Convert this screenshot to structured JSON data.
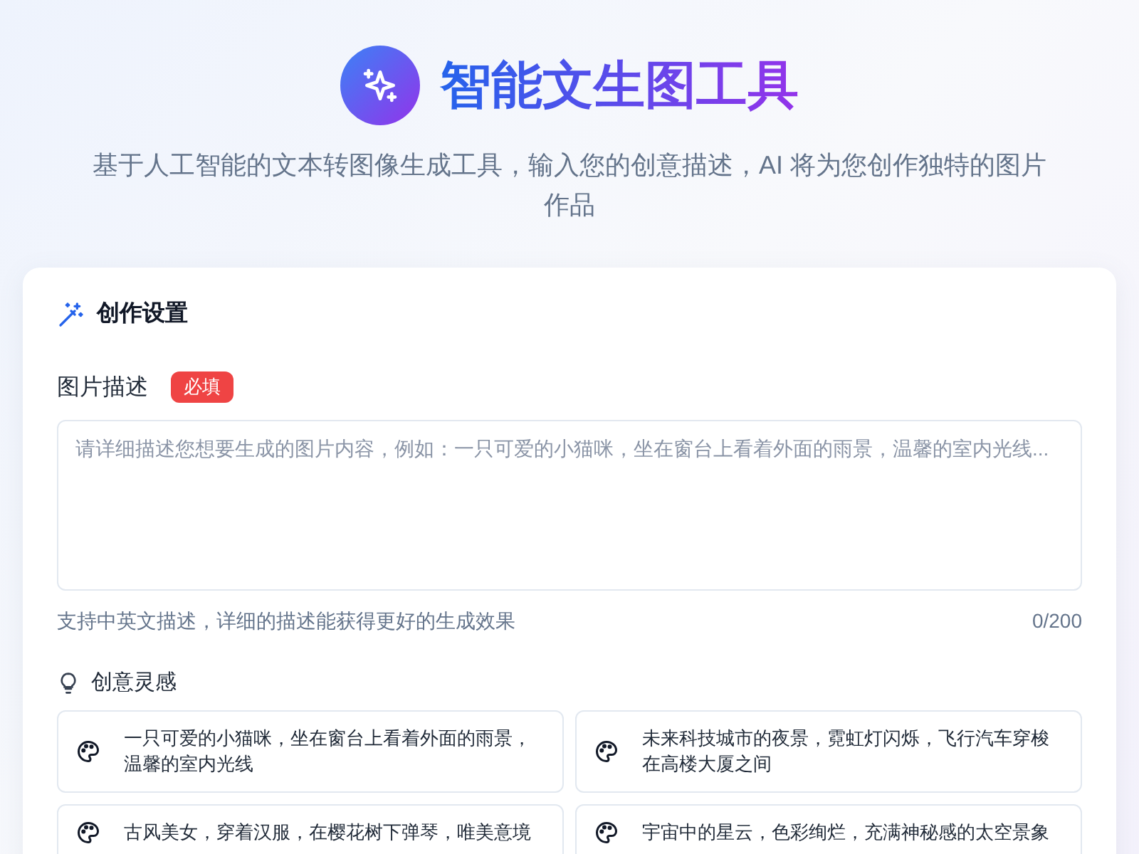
{
  "header": {
    "title": "智能文生图工具",
    "subtitle": "基于人工智能的文本转图像生成工具，输入您的创意描述，AI 将为您创作独特的图片作品"
  },
  "settings": {
    "title": "创作设置",
    "prompt": {
      "label": "图片描述",
      "badge": "必填",
      "placeholder": "请详细描述您想要生成的图片内容，例如：一只可爱的小猫咪，坐在窗台上看着外面的雨景，温馨的室内光线...",
      "hint": "支持中英文描述，详细的描述能获得更好的生成效果",
      "counter": "0/200"
    },
    "inspiration": {
      "title": "创意灵感",
      "items": [
        {
          "text": "一只可爱的小猫咪，坐在窗台上看着外面的雨景，温馨的室内光线"
        },
        {
          "text": "未来科技城市的夜景，霓虹灯闪烁，飞行汽车穿梭在高楼大厦之间"
        },
        {
          "text": "古风美女，穿着汉服，在樱花树下弹琴，唯美意境"
        },
        {
          "text": "宇宙中的星云，色彩绚烂，充满神秘感的太空景象"
        }
      ]
    }
  }
}
